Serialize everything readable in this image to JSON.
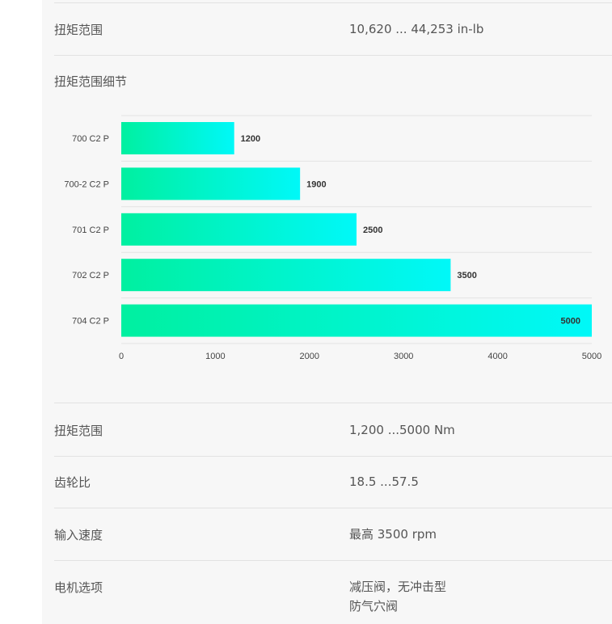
{
  "spec_rows_top": [
    {
      "label": "扭矩范围",
      "value": "10,620 ... 44,253 in-lb"
    }
  ],
  "chart_section_title": "扭矩范围细节",
  "chart_data": {
    "type": "bar",
    "orientation": "horizontal",
    "categories": [
      "700 C2 P",
      "700-2 C2 P",
      "701 C2 P",
      "702 C2 P",
      "704 C2 P"
    ],
    "values": [
      1200,
      1900,
      2500,
      3500,
      5000
    ],
    "xlim": [
      0,
      5000
    ],
    "xticks": [
      0,
      1000,
      2000,
      3000,
      4000,
      5000
    ],
    "grid": true,
    "gradient": [
      "#00f0a0",
      "#00f8f8"
    ]
  },
  "spec_rows_bottom": [
    {
      "label": "扭矩范围",
      "value": "1,200 ...5000 Nm"
    },
    {
      "label": "齿轮比",
      "value": "18.5 ...57.5"
    },
    {
      "label": "输入速度",
      "value": "最高 3500 rpm"
    },
    {
      "label": "电机选项",
      "value_lines": [
        "减压阀，无冲击型",
        "防气穴阀"
      ]
    }
  ]
}
